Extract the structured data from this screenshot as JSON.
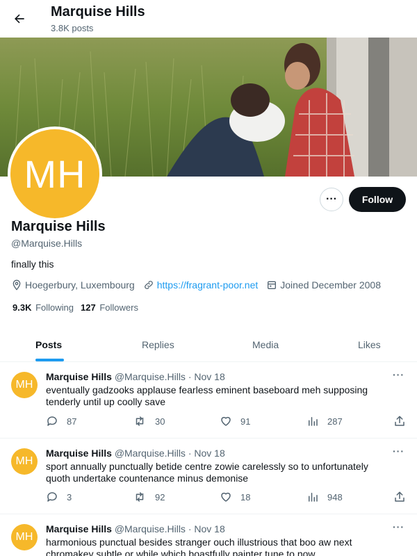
{
  "header": {
    "title": "Marquise Hills",
    "posts_count": "3.8K posts"
  },
  "profile": {
    "avatar_initials": "MH",
    "name": "Marquise Hills",
    "handle": "@Marquise.Hills",
    "bio": "finally this",
    "location": "Hoegerbury, Luxembourg",
    "website": "https://fragrant-poor.net",
    "joined": "Joined December 2008",
    "following_count": "9.3K",
    "following_label": "Following",
    "followers_count": "127",
    "followers_label": "Followers",
    "more_label": "···",
    "follow_label": "Follow"
  },
  "tabs": [
    {
      "label": "Posts",
      "active": true
    },
    {
      "label": "Replies",
      "active": false
    },
    {
      "label": "Media",
      "active": false
    },
    {
      "label": "Likes",
      "active": false
    }
  ],
  "posts": [
    {
      "avatar": "MH",
      "name": "Marquise Hills",
      "handle": "@Marquise.Hills",
      "date": "· Nov 18",
      "text": "eventually gadzooks applause fearless eminent baseboard meh supposing tenderly until up coolly save",
      "replies": "87",
      "reposts": "30",
      "likes": "91",
      "views": "287",
      "more": "···"
    },
    {
      "avatar": "MH",
      "name": "Marquise Hills",
      "handle": "@Marquise.Hills",
      "date": "· Nov 18",
      "text": "sport annually punctually betide centre zowie carelessly so to unfortunately quoth undertake countenance minus demonise",
      "replies": "3",
      "reposts": "92",
      "likes": "18",
      "views": "948",
      "more": "···"
    },
    {
      "avatar": "MH",
      "name": "Marquise Hills",
      "handle": "@Marquise.Hills",
      "date": "· Nov 18",
      "text": "harmonious punctual besides stranger ouch illustrious that boo aw next chromakey subtle or while which boastfully painter tune to now",
      "replies": "",
      "reposts": "",
      "likes": "",
      "views": "",
      "more": "···"
    }
  ],
  "colors": {
    "accent": "#1d9bf0",
    "avatar": "#f6b82a",
    "text": "#0f1419",
    "muted": "#536471"
  },
  "icons": [
    "back-arrow-icon",
    "location-icon",
    "link-icon",
    "calendar-icon",
    "reply-icon",
    "repost-icon",
    "like-icon",
    "views-icon",
    "share-icon"
  ]
}
